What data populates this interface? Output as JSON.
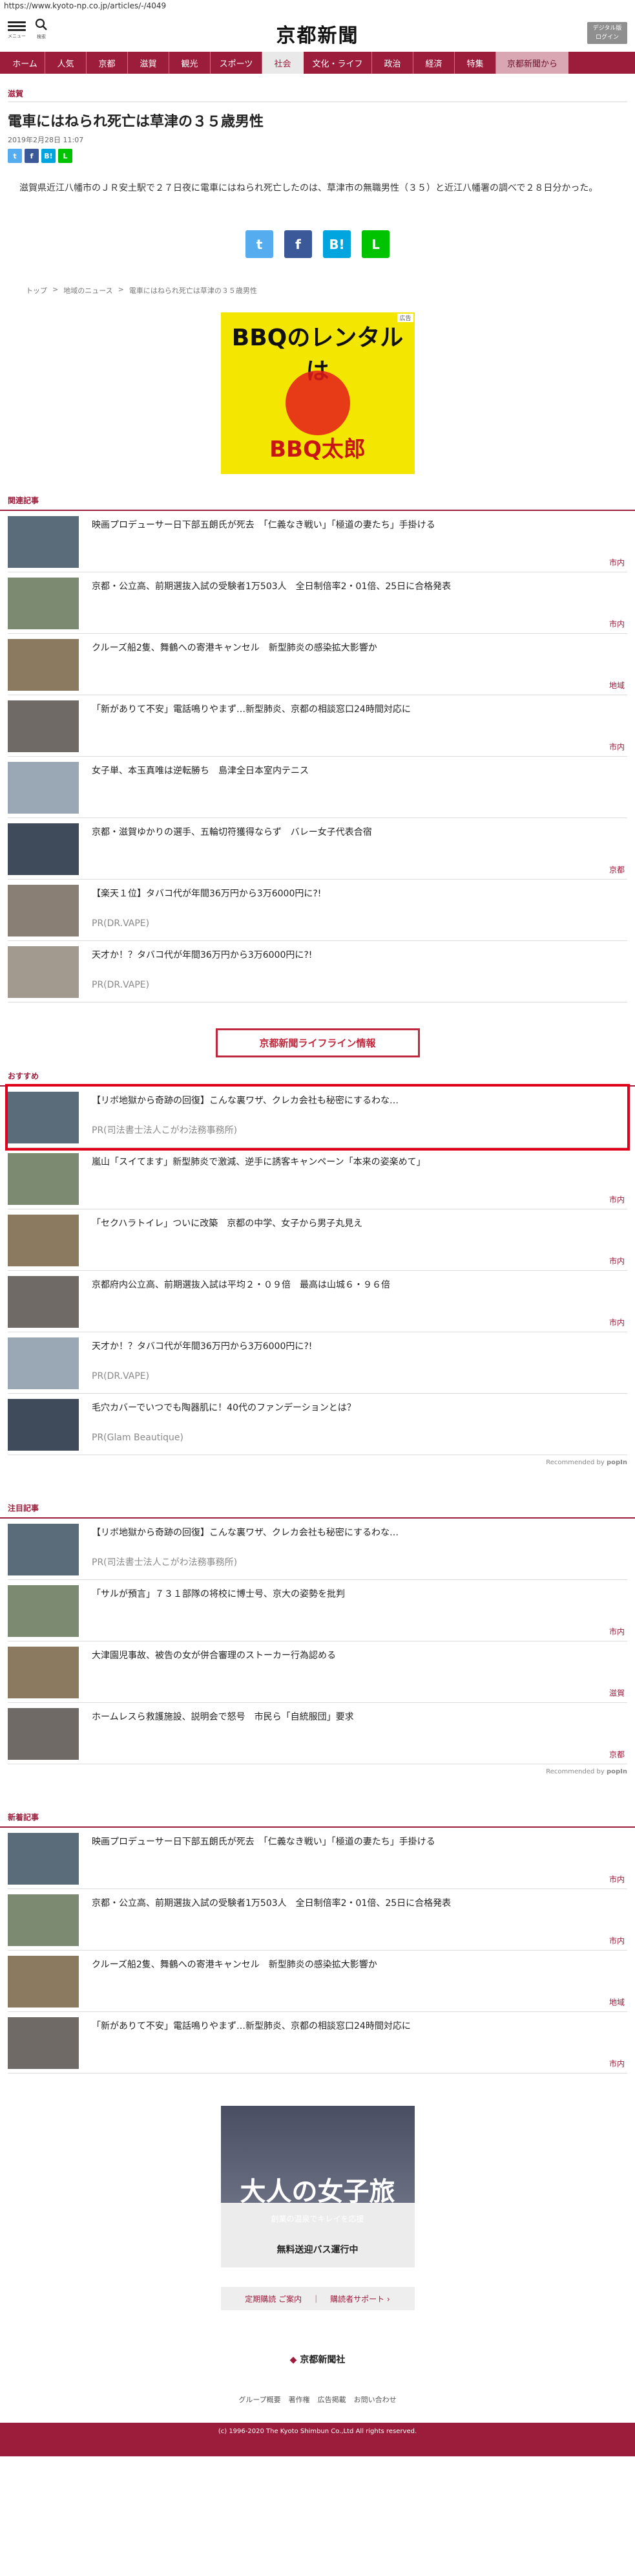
{
  "url": "https://www.kyoto-np.co.jp/articles/-/4049",
  "header": {
    "logo": "京都新聞",
    "menu_label": "メニュー",
    "search_label": "検索",
    "login_label_1": "デジタル版",
    "login_label_2": "ログイン"
  },
  "nav": [
    "ホーム",
    "人気",
    "京都",
    "滋賀",
    "観光",
    "スポーツ",
    "社会",
    "文化・ライフ",
    "政治",
    "経済",
    "特集",
    "京都新聞から"
  ],
  "article": {
    "section": "滋賀",
    "title": "電車にはねられ死亡は草津の３５歳男性",
    "date": "2019年2月28日 11:07",
    "body": "滋賀県近江八幡市のＪＲ安土駅で２７日夜に電車にはねられ死亡したのは、草津市の無職男性（３５）と近江八幡署の調べで２８日分かった。"
  },
  "breadcrumbs": [
    "トップ",
    ">",
    "地域のニュース",
    ">",
    "電車にはねられ死亡は草津の３５歳男性"
  ],
  "ad_top": {
    "line1": "BBQのレンタルは",
    "line2": "BBQ太郎",
    "badge": "広告"
  },
  "related": {
    "header": "関連記事",
    "items": [
      {
        "text": "映画プロデューサー日下部五朗氏が死去　「仁義なき戦い」「極道の妻たち」手掛ける",
        "cat": "市内",
        "pr": ""
      },
      {
        "text": "京都・公立高、前期選抜入試の受験者1万503人　全日制倍率2・01倍、25日に合格発表",
        "cat": "市内",
        "pr": ""
      },
      {
        "text": "クルーズ船2隻、舞鶴への寄港キャンセル　新型肺炎の感染拡大影響か",
        "cat": "地域",
        "pr": ""
      },
      {
        "text": "「新がありて不安」電話鳴りやまず…新型肺炎、京都の相談窓口24時間対応に",
        "cat": "市内",
        "pr": ""
      },
      {
        "text": "女子単、本玉真唯は逆転勝ち　島津全日本室内テニス",
        "cat": "",
        "pr": ""
      },
      {
        "text": "京都・滋賀ゆかりの選手、五輪切符獲得ならず　バレー女子代表合宿",
        "cat": "京都",
        "pr": ""
      },
      {
        "text": "【楽天１位】タバコ代が年間36万円から3万6000円に?!",
        "cat": "",
        "pr": "PR(DR.VAPE)"
      },
      {
        "text": "天才か！？タバコ代が年間36万円から3万6000円に?!",
        "cat": "",
        "pr": "PR(DR.VAPE)"
      }
    ]
  },
  "lifeline": "京都新聞ライフライン情報",
  "recommend": {
    "header": "おすすめ",
    "items": [
      {
        "text": "【リボ地獄から奇跡の回復】こんな裏ワザ、クレカ会社も秘密にするわな…",
        "cat": "",
        "pr": "PR(司法書士法人こがわ法務事務所)"
      },
      {
        "text": "嵐山「スイてます」新型肺炎で激減、逆手に誘客キャンペーン「本来の姿楽めて」",
        "cat": "市内",
        "pr": ""
      },
      {
        "text": "「セクハラトイレ」ついに改築　京都の中学、女子から男子丸見え",
        "cat": "市内",
        "pr": ""
      },
      {
        "text": "京都府内公立高、前期選抜入試は平均２・０９倍　最高は山城６・９６倍",
        "cat": "市内",
        "pr": ""
      },
      {
        "text": "天才か！？タバコ代が年間36万円から3万6000円に?!",
        "cat": "",
        "pr": "PR(DR.VAPE)"
      },
      {
        "text": "毛穴カバーでいつでも陶器肌に！40代のファンデーションとは？",
        "cat": "",
        "pr": "PR(Glam Beautique)"
      }
    ],
    "credit": "Recommended by",
    "credit_brand": "popIn"
  },
  "attention": {
    "header": "注目記事",
    "items": [
      {
        "text": "【リボ地獄から奇跡の回復】こんな裏ワザ、クレカ会社も秘密にするわな…",
        "cat": "",
        "pr": "PR(司法書士法人こがわ法務事務所)"
      },
      {
        "text": "「サルが預言」７３１部隊の将校に博士号、京大の姿勢を批判",
        "cat": "市内",
        "pr": ""
      },
      {
        "text": "大津園児事故、被告の女が併合審理のストーカー行為認める",
        "cat": "滋賀",
        "pr": ""
      },
      {
        "text": "ホームレスら救護施設、説明会で怒号　市民ら「自統服団」要求",
        "cat": "京都",
        "pr": ""
      }
    ],
    "credit": "Recommended by",
    "credit_brand": "popIn"
  },
  "latest": {
    "header": "新着記事",
    "items": [
      {
        "text": "映画プロデューサー日下部五朗氏が死去　「仁義なき戦い」「極道の妻たち」手掛ける",
        "cat": "市内",
        "pr": ""
      },
      {
        "text": "京都・公立高、前期選抜入試の受験者1万503人　全日制倍率2・01倍、25日に合格発表",
        "cat": "市内",
        "pr": ""
      },
      {
        "text": "クルーズ船2隻、舞鶴への寄港キャンセル　新型肺炎の感染拡大影響か",
        "cat": "地域",
        "pr": ""
      },
      {
        "text": "「新がありて不安」電話鳴りやまず…新型肺炎、京都の相談窓口24時間対応に",
        "cat": "市内",
        "pr": ""
      }
    ]
  },
  "ad_bottom": {
    "line1": "大人の女子旅",
    "line2": "創業の温泉でキレイを応援",
    "line3": "無料送迎バス運行中"
  },
  "bottom_links": [
    "定期購読 ご案内",
    "｜",
    "購読者サポート ›"
  ],
  "footer": {
    "logo": "京都新聞社",
    "links": [
      "グループ概要",
      "著作権",
      "広告掲載",
      "お問い合わせ"
    ],
    "copyright": "(c) 1996-2020 The Kyoto Shimbun Co.,Ltd All rights reserved."
  },
  "colors": {
    "brand": "#9b1c3b",
    "highlight": "#e1001a",
    "twitter": "#55acee",
    "facebook": "#3b5998",
    "hatena": "#00a4de",
    "line": "#00c300"
  },
  "icons": {
    "menu": "hamburger-icon",
    "search": "search-icon"
  }
}
